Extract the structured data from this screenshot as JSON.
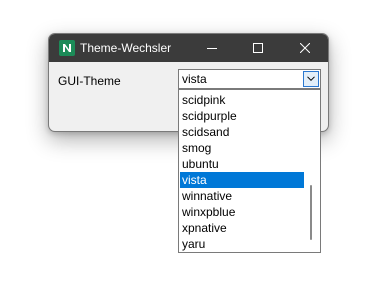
{
  "window": {
    "title": "Theme-Wechsler",
    "app_icon": "app-logo-icon",
    "controls": {
      "minimize": "minimize-icon",
      "maximize": "maximize-icon",
      "close": "close-icon"
    }
  },
  "form": {
    "label": "GUI-Theme",
    "combo": {
      "value": "vista",
      "dropdown_icon": "chevron-down-icon"
    }
  },
  "dropdown": {
    "items": [
      {
        "label": "scidpink"
      },
      {
        "label": "scidpurple"
      },
      {
        "label": "scidsand"
      },
      {
        "label": "smog"
      },
      {
        "label": "ubuntu"
      },
      {
        "label": "vista",
        "selected": true
      },
      {
        "label": "winnative"
      },
      {
        "label": "winxpblue"
      },
      {
        "label": "xpnative"
      },
      {
        "label": "yaru"
      }
    ]
  },
  "colors": {
    "titlebar": "#3b3b3b",
    "selection": "#0078d7",
    "app_icon": "#1c8b58"
  }
}
